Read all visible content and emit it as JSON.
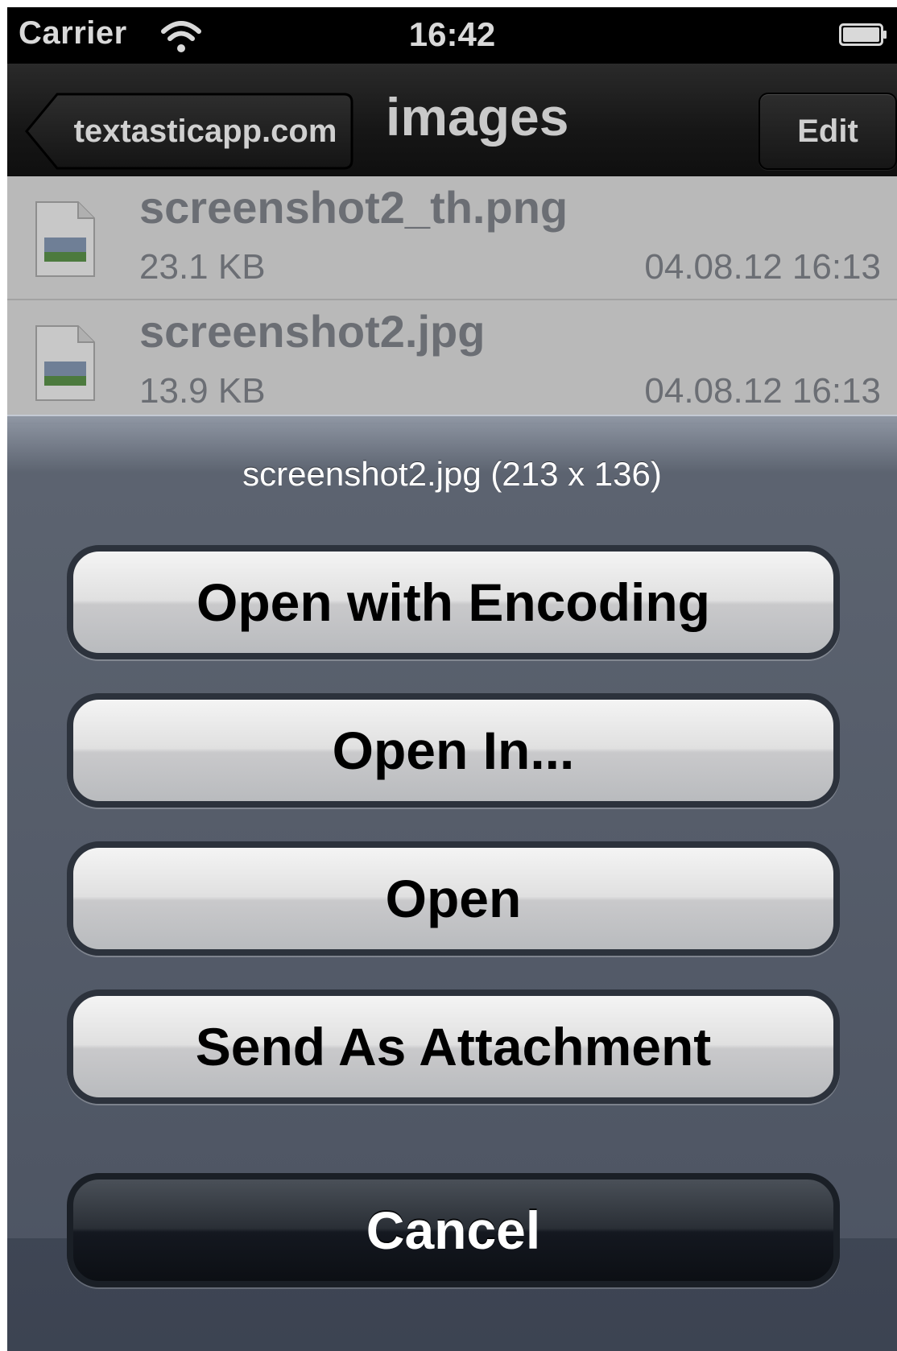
{
  "status_bar": {
    "carrier": "Carrier",
    "time": "16:42",
    "wifi_icon": "wifi-icon",
    "battery_icon": "battery-icon"
  },
  "nav_bar": {
    "back_label": "textasticapp.com",
    "title": "images",
    "edit_label": "Edit"
  },
  "files": [
    {
      "name": "screenshot2_th.png",
      "size": "23.1 KB",
      "date": "04.08.12 16:13"
    },
    {
      "name": "screenshot2.jpg",
      "size": "13.9 KB",
      "date": "04.08.12 16:13"
    }
  ],
  "action_sheet": {
    "title": "screenshot2.jpg (213 x 136)",
    "buttons": [
      {
        "label": "Open with Encoding"
      },
      {
        "label": "Open In..."
      },
      {
        "label": "Open"
      },
      {
        "label": "Send As Attachment"
      }
    ],
    "cancel_label": "Cancel"
  },
  "colors": {
    "sheet_background": "#4a5262",
    "light_button": "#d9d9d9",
    "cancel_button": "#1c2028"
  }
}
